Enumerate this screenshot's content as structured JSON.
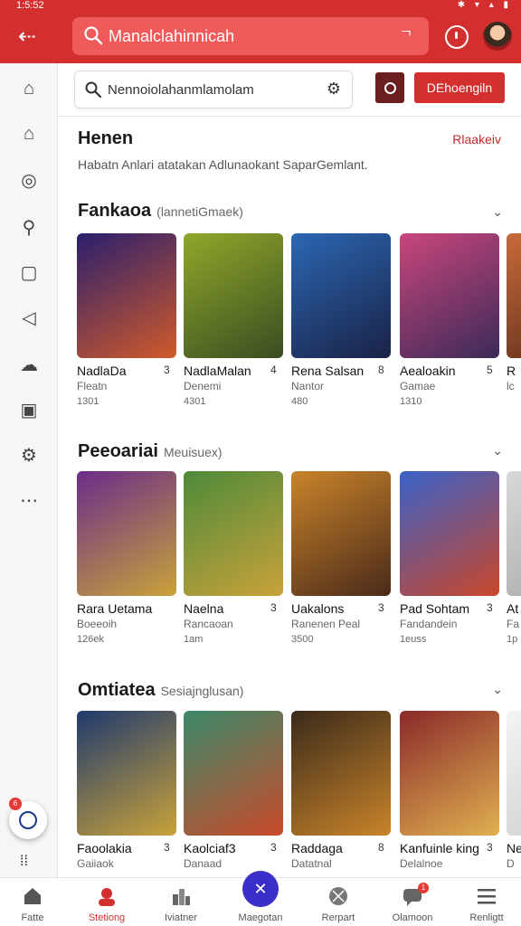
{
  "status": {
    "time": "1:5:52"
  },
  "topbar": {
    "search_text": "Manalclahinnicah",
    "mic_glyph": "ᄀ"
  },
  "search2": {
    "text": "Nennoiolahanmlamolam"
  },
  "button": {
    "label": "DEhoengiln"
  },
  "home": {
    "title": "Henen",
    "link": "Rlaakeiv",
    "subtitle": "Habatn Anlari atatakan Adlunaokant SaparGemlant."
  },
  "sections": [
    {
      "title": "Fankaoa",
      "subtitle": "(lannetiGmaek)",
      "cards": [
        {
          "title": "NadlaDa",
          "num": "3",
          "sub": "Fleatn",
          "meta": "1301",
          "colors": [
            "#2a1f6e",
            "#d05a2a"
          ]
        },
        {
          "title": "NadlaMalan",
          "num": "4",
          "sub": "Denemi",
          "meta": "4301",
          "colors": [
            "#8fa82a",
            "#3b4c22"
          ]
        },
        {
          "title": "Rena Salsan",
          "num": "8",
          "sub": "Nantor",
          "meta": "480",
          "colors": [
            "#2b67b3",
            "#1a2246"
          ]
        },
        {
          "title": "Aealoakin",
          "num": "5",
          "sub": "Gamae",
          "meta": "1310",
          "colors": [
            "#c9467c",
            "#3b2a58"
          ]
        },
        {
          "title": "R",
          "num": "",
          "sub": "lc",
          "meta": "",
          "colors": [
            "#c96a3a",
            "#552a1a"
          ]
        }
      ]
    },
    {
      "title": "Peeoariai",
      "subtitle": "Meuisuex)",
      "cards": [
        {
          "title": "Rara Uetama",
          "num": "",
          "sub": "Boeeoih",
          "meta": "126ek",
          "colors": [
            "#6a2c8a",
            "#c9a23a"
          ]
        },
        {
          "title": "Naelna",
          "num": "3",
          "sub": "Rancaoan",
          "meta": "1am",
          "colors": [
            "#4d8a3a",
            "#c9a23a"
          ]
        },
        {
          "title": "Uakalons",
          "num": "3",
          "sub": "Ranenen Peal",
          "meta": "3500",
          "colors": [
            "#c9842a",
            "#4a2a1a"
          ]
        },
        {
          "title": "Pad Sohtam",
          "num": "3",
          "sub": "Fandandein",
          "meta": "1euss",
          "colors": [
            "#3a62c9",
            "#c9462a"
          ]
        },
        {
          "title": "At",
          "num": "",
          "sub": "Fa",
          "meta": "1p",
          "colors": [
            "#d8d8d8",
            "#a8a8a8"
          ]
        }
      ]
    },
    {
      "title": "Omtiatea",
      "subtitle": "Sesiajnglusan)",
      "cards": [
        {
          "title": "Faoolakia",
          "num": "3",
          "sub": "Gaiiaok",
          "meta": "",
          "colors": [
            "#1f3a6e",
            "#c9a23a"
          ]
        },
        {
          "title": "Kaolciaf3",
          "num": "3",
          "sub": "Danaad",
          "meta": "",
          "colors": [
            "#3a8a6a",
            "#c94a2a"
          ]
        },
        {
          "title": "Raddaga",
          "num": "8",
          "sub": "Datatnal",
          "meta": "",
          "colors": [
            "#3a2a1a",
            "#c9842a"
          ]
        },
        {
          "title": "Kanfuinle king",
          "num": "3",
          "sub": "Delalnoe",
          "meta": "",
          "colors": [
            "#8a2a2a",
            "#e0b050"
          ]
        },
        {
          "title": "Ne",
          "num": "",
          "sub": "D",
          "meta": "",
          "colors": [
            "#f4f4f4",
            "#cccccc"
          ]
        }
      ]
    }
  ],
  "rail_icons": [
    "home-icon",
    "store-icon",
    "shield-icon",
    "search-icon",
    "frame-icon",
    "tag-icon",
    "cloud-icon",
    "image-icon",
    "settings-icon",
    "more-icon"
  ],
  "rail_badge": "6",
  "bottom_nav": [
    {
      "label": "Fatte",
      "icon": "home-icon"
    },
    {
      "label": "Stetiong",
      "icon": "person-icon",
      "active": true
    },
    {
      "label": "Iviatner",
      "icon": "chart-icon"
    },
    {
      "label": "Maegotan",
      "icon": "compass-icon"
    },
    {
      "label": "Rerpart",
      "icon": "ball-icon"
    },
    {
      "label": "Olamoon",
      "icon": "chat-icon"
    },
    {
      "label": "Renligtt",
      "icon": "menu-icon"
    }
  ],
  "nav_badge": "1",
  "colors": {
    "brand": "#d32f2f",
    "accent": "#3b2fc9"
  }
}
